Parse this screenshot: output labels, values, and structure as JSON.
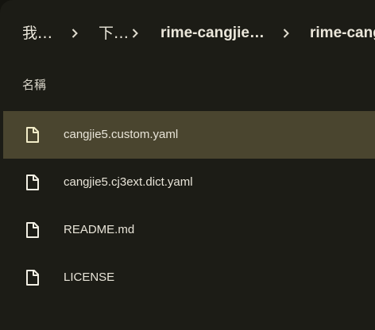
{
  "breadcrumb": {
    "items": [
      {
        "label": "我…"
      },
      {
        "label": "下…"
      },
      {
        "label": "rime-cangjie…"
      },
      {
        "label": "rime-cang"
      }
    ]
  },
  "list": {
    "header": "名稱",
    "files": [
      {
        "name": "cangjie5.custom.yaml",
        "icon": "file-icon",
        "selected": true
      },
      {
        "name": "cangjie5.cj3ext.dict.yaml",
        "icon": "file-icon",
        "selected": false
      },
      {
        "name": "README.md",
        "icon": "file-icon",
        "selected": false
      },
      {
        "name": "LICENSE",
        "icon": "file-icon",
        "selected": false
      }
    ]
  },
  "colors": {
    "background": "#1c1c16",
    "selected_row": "#4a452f",
    "text": "#e8e4d8"
  }
}
